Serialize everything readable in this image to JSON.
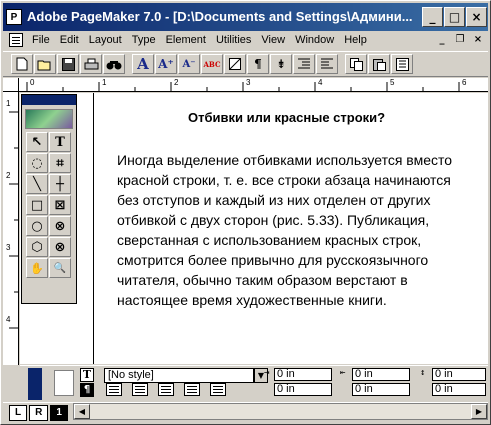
{
  "window": {
    "title": "Adobe PageMaker 7.0 - [D:\\Documents and Settings\\Админи...",
    "app_icon_letter": "P",
    "minimize": "_",
    "maximize": "□",
    "close": "×"
  },
  "menu": {
    "items": [
      "File",
      "Edit",
      "Layout",
      "Type",
      "Element",
      "Utilities",
      "View",
      "Window",
      "Help"
    ],
    "doc_minimize": "_",
    "doc_restore": "❐",
    "doc_close": "×"
  },
  "toolbar": {
    "icons": [
      "new-icon",
      "open-icon",
      "save-icon",
      "print-icon",
      "find-icon",
      "font-icon",
      "font-larger-icon",
      "font-smaller-icon",
      "spelling-icon",
      "frame-icon",
      "paragraph-icon",
      "text-flow-icon",
      "indent-icon",
      "outdent-icon",
      "copy-icon",
      "paste-icon",
      "cut-icon"
    ],
    "font_label": "A",
    "spell_label": "ABC",
    "para_label": "¶"
  },
  "ruler": {
    "h_marks": [
      "0",
      "1",
      "2",
      "3",
      "4",
      "5",
      "6"
    ],
    "v_marks": [
      "1",
      "2",
      "3",
      "4"
    ]
  },
  "document": {
    "heading": "Отбивки или красные строки?",
    "paragraph": "Иногда выделение отбивками используется вместо\nкрасной строки, т. е. все строки абзаца начинаются\nбез отступов и каждый из них отделен от других\nотбивкой с двух сторон (рис. 5.33). Публикация,\nсверстанная с использованием красных строк,\nсмотрится более привычно для русскоязычного\nчитателя, обычно таким образом верстают в\nнастоящее время художественные книги."
  },
  "toolbox": {
    "tools": [
      "pointer-tool",
      "text-tool",
      "rotate-tool",
      "crop-tool",
      "line-tool",
      "constrained-line-tool",
      "rectangle-tool",
      "rectangle-frame-tool",
      "ellipse-tool",
      "ellipse-frame-tool",
      "polygon-tool",
      "polygon-frame-tool",
      "hand-tool",
      "zoom-tool"
    ],
    "glyphs": [
      "↖",
      "T",
      "◌",
      "⌗",
      "╲",
      "┼",
      "□",
      "⊠",
      "○",
      "⊗",
      "⬡",
      "⊗",
      "✋",
      "🔍"
    ]
  },
  "control_palette": {
    "char_mode": "T",
    "para_mode": "¶",
    "style": "[No style]",
    "indent_left": "0 in",
    "indent_first": "0 in",
    "indent_right": "0 in",
    "space_before": "0 in",
    "space_after": "0 in",
    "grid": "0 in",
    "extra": "0 in"
  },
  "status": {
    "left_page": "L",
    "right_page": "R",
    "page_one": "1"
  }
}
